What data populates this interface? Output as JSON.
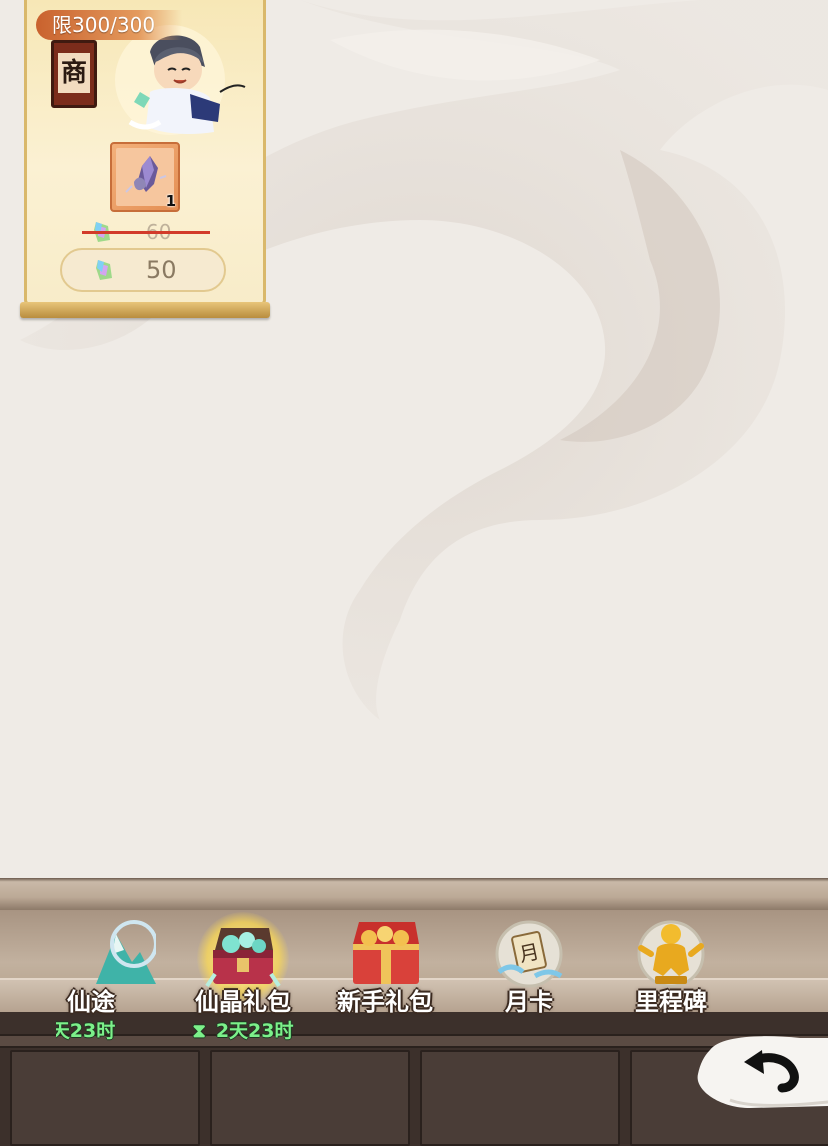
{
  "shop_card": {
    "limit_label": "限300/300",
    "sign_char": "商",
    "item_quantity": "1",
    "original_price": "60",
    "current_price": "50",
    "currency_icon": "crystal-icon"
  },
  "bottom_nav": {
    "items": [
      {
        "label": "仙途",
        "timer": "天23时",
        "icon": "mountain-icon"
      },
      {
        "label": "仙晶礼包",
        "timer": "2天23时",
        "icon": "treasure-chest-icon",
        "selected": true
      },
      {
        "label": "新手礼包",
        "icon": "gift-chest-icon"
      },
      {
        "label": "月卡",
        "icon": "month-card-icon"
      },
      {
        "label": "里程碑",
        "icon": "golden-statue-icon"
      }
    ],
    "timer_prefix_icon": "hourglass-icon"
  },
  "back_button": {
    "icon": "back-arrow-icon"
  },
  "colors": {
    "background": "#efebe6",
    "card_gold": "#d9b86b",
    "badge_orange": "#c9622e",
    "timer_green": "#7cf08a",
    "strike_red": "#d23b2a"
  }
}
